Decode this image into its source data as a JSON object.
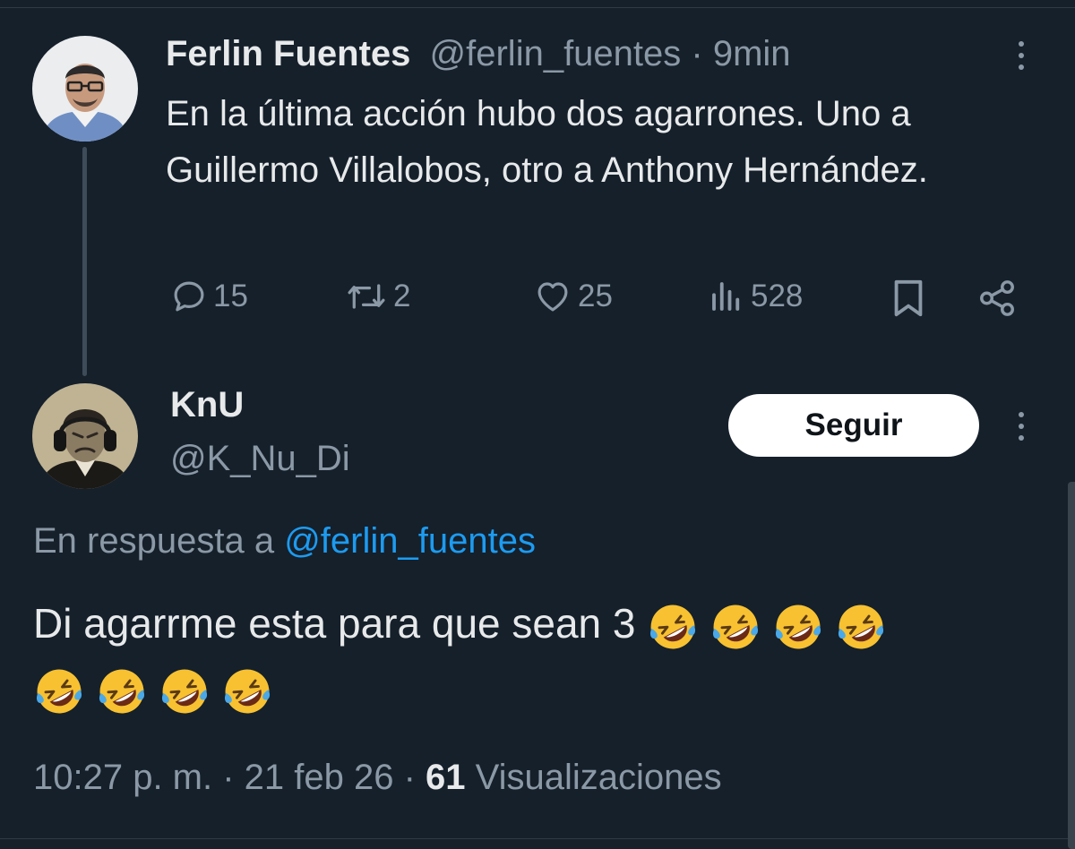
{
  "original_tweet": {
    "author_name": "Ferlin Fuentes",
    "author_handle": "@ferlin_fuentes",
    "separator": " · ",
    "time": "9min",
    "text": "En la última acción hubo dos agarrones. Uno a Guillermo Villalobos, otro a Anthony Hernández.",
    "actions": {
      "replies": "15",
      "retweets": "2",
      "likes": "25",
      "views": "528"
    }
  },
  "reply_tweet": {
    "author_name": "KnU",
    "author_handle": "@K_Nu_Di",
    "follow_label": "Seguir",
    "replying_prefix": "En respuesta a ",
    "replying_to": "@ferlin_fuentes",
    "text": "Di agarrme esta para que sean 3",
    "emoji_count": 8,
    "emoji_name": "rolling-on-the-floor-laughing-emoji",
    "timestamp": "10:27 p. m. · 21 feb 26 · ",
    "view_count": "61",
    "view_label": " Visualizaciones"
  },
  "colors": {
    "background": "#15202b",
    "text": "#e7e9ea",
    "muted": "#8b98a5",
    "accent": "#1d9bf0"
  }
}
